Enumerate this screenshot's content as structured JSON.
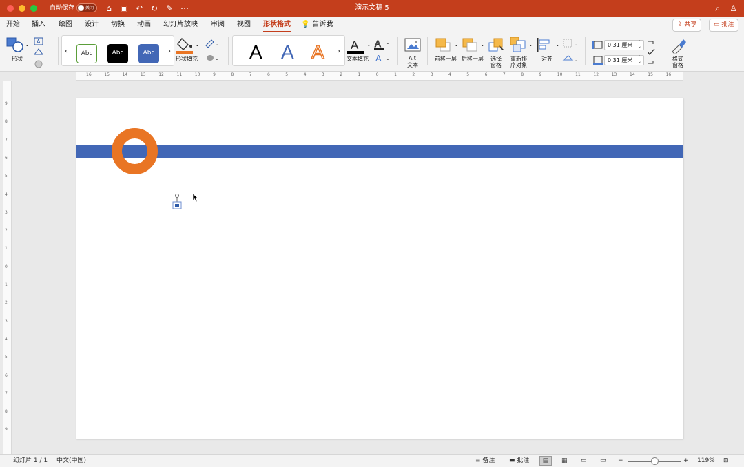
{
  "window": {
    "title": "演示文稿 5",
    "autosave_label": "自动保存",
    "autosave_state": "关闭"
  },
  "tabs": [
    "开始",
    "插入",
    "绘图",
    "设计",
    "切换",
    "动画",
    "幻灯片放映",
    "审阅",
    "视图",
    "形状格式",
    "告诉我"
  ],
  "active_tab": "形状格式",
  "actions": {
    "share": "共享",
    "comments": "批注"
  },
  "ribbon": {
    "shape_label": "形状",
    "shape_styles": [
      "Abc",
      "Abc",
      "Abc"
    ],
    "shape_fill_label": "形状填充",
    "wordart_letters": [
      "A",
      "A",
      "A"
    ],
    "text_fill_label": "文本填充",
    "alt_text_label_1": "Alt",
    "alt_text_label_2": "文本",
    "bring_forward": "前移一层",
    "send_backward": "后移一层",
    "selection_pane_1": "选择",
    "selection_pane_2": "窗格",
    "reorder_1": "重新排",
    "reorder_2": "序对象",
    "align": "对齐",
    "height_value": "0.31 厘米",
    "width_value": "0.31 厘米",
    "format_pane_1": "格式",
    "format_pane_2": "窗格"
  },
  "ruler": {
    "h": [
      "16",
      "15",
      "14",
      "13",
      "12",
      "11",
      "10",
      "9",
      "8",
      "7",
      "6",
      "5",
      "4",
      "3",
      "2",
      "1",
      "0",
      "1",
      "2",
      "3",
      "4",
      "5",
      "6",
      "7",
      "8",
      "9",
      "10",
      "11",
      "12",
      "13",
      "14",
      "15",
      "16"
    ],
    "v": [
      "9",
      "8",
      "7",
      "6",
      "5",
      "4",
      "3",
      "2",
      "1",
      "0",
      "1",
      "2",
      "3",
      "4",
      "5",
      "6",
      "7",
      "8",
      "9"
    ]
  },
  "status": {
    "slide": "幻灯片 1 / 1",
    "language": "中文(中国)",
    "notes": "备注",
    "comments": "批注",
    "zoom": "119%"
  },
  "colors": {
    "accent": "#c43e1c",
    "bar": "#4267b6",
    "ring": "#e97524"
  }
}
